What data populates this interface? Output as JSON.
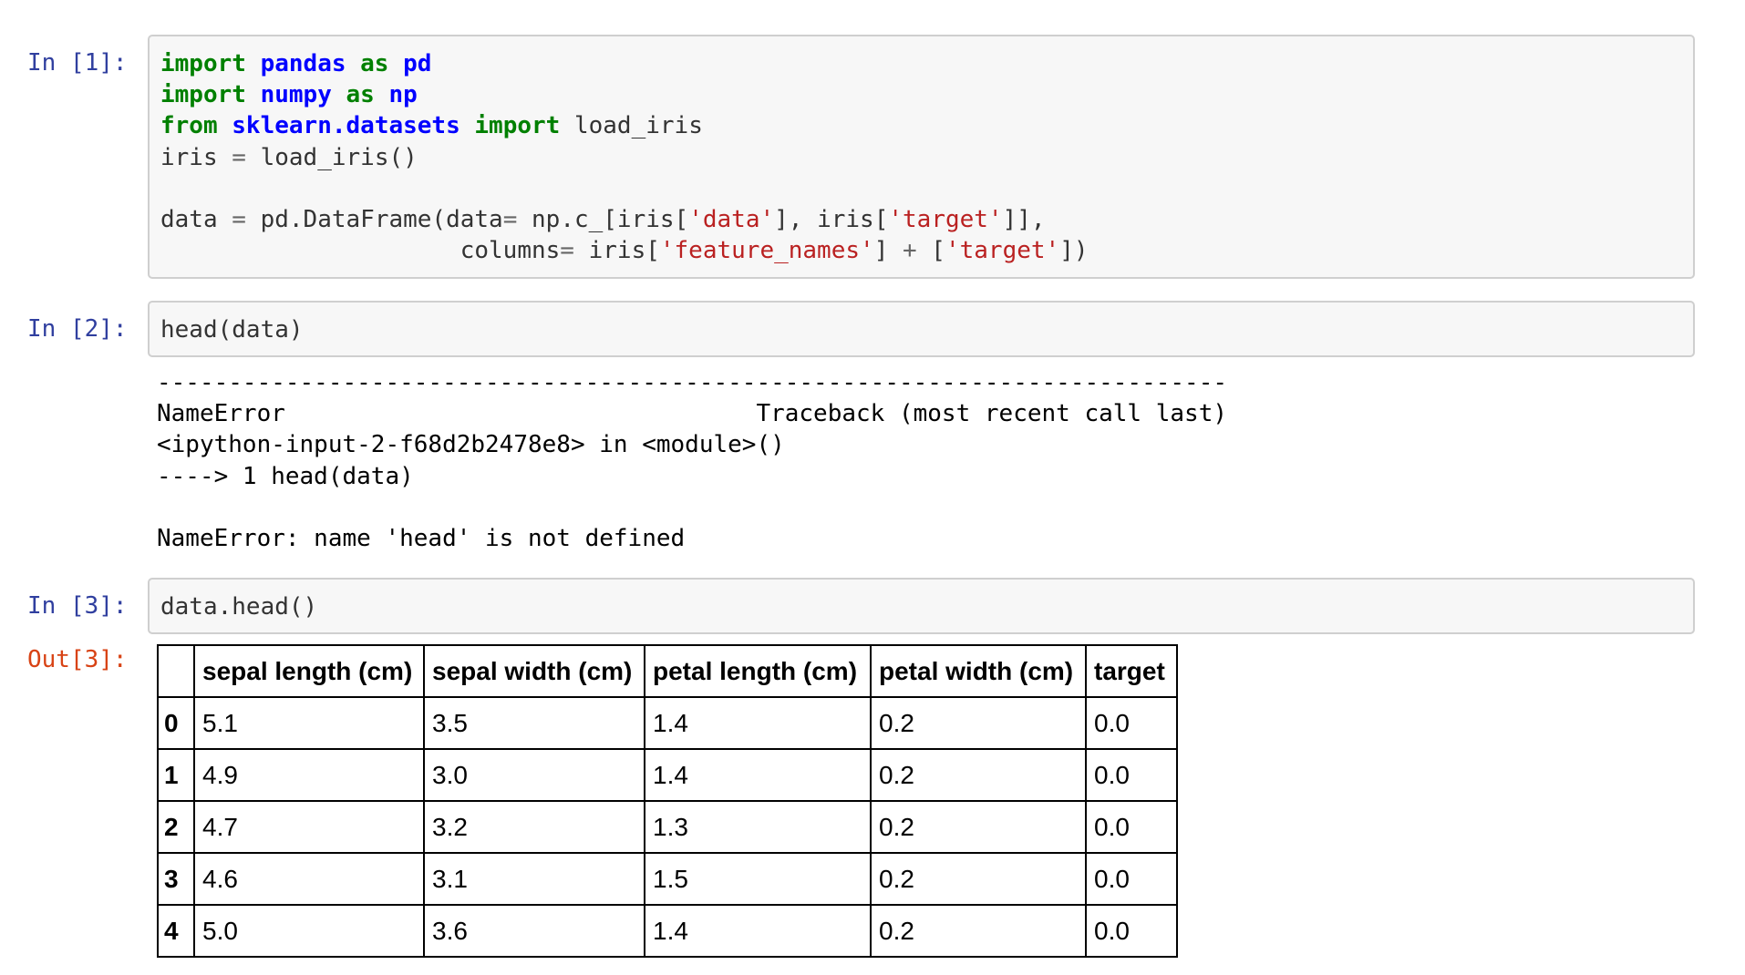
{
  "cells": [
    {
      "prompt": "In [1]:",
      "lines": [
        [
          [
            "kw",
            "import"
          ],
          [
            "t",
            " "
          ],
          [
            "mod",
            "pandas"
          ],
          [
            "t",
            " "
          ],
          [
            "kw",
            "as"
          ],
          [
            "t",
            " "
          ],
          [
            "mod",
            "pd"
          ]
        ],
        [
          [
            "kw",
            "import"
          ],
          [
            "t",
            " "
          ],
          [
            "mod",
            "numpy"
          ],
          [
            "t",
            " "
          ],
          [
            "kw",
            "as"
          ],
          [
            "t",
            " "
          ],
          [
            "mod",
            "np"
          ]
        ],
        [
          [
            "kw",
            "from"
          ],
          [
            "t",
            " "
          ],
          [
            "mod",
            "sklearn.datasets"
          ],
          [
            "t",
            " "
          ],
          [
            "kw",
            "import"
          ],
          [
            "t",
            " load_iris"
          ]
        ],
        [
          [
            "t",
            "iris "
          ],
          [
            "op",
            "="
          ],
          [
            "t",
            " load_iris()"
          ]
        ],
        [
          [
            "t",
            ""
          ]
        ],
        [
          [
            "t",
            "data "
          ],
          [
            "op",
            "="
          ],
          [
            "t",
            " pd.DataFrame(data"
          ],
          [
            "op",
            "="
          ],
          [
            "t",
            " np.c_[iris["
          ],
          [
            "str",
            "'data'"
          ],
          [
            "t",
            "], iris["
          ],
          [
            "str",
            "'target'"
          ],
          [
            "t",
            "]],"
          ]
        ],
        [
          [
            "t",
            "                     columns"
          ],
          [
            "op",
            "="
          ],
          [
            "t",
            " iris["
          ],
          [
            "str",
            "'feature_names'"
          ],
          [
            "t",
            "] "
          ],
          [
            "op",
            "+"
          ],
          [
            "t",
            " ["
          ],
          [
            "str",
            "'target'"
          ],
          [
            "t",
            "])"
          ]
        ]
      ]
    },
    {
      "prompt": "In [2]:",
      "lines": [
        [
          [
            "t",
            "head(data)"
          ]
        ]
      ]
    },
    {
      "prompt": "In [3]:",
      "lines": [
        [
          [
            "t",
            "data.head()"
          ]
        ]
      ]
    }
  ],
  "traceback": {
    "lines": [
      "---------------------------------------------------------------------------",
      "NameError                                 Traceback (most recent call last)",
      "<ipython-input-2-f68d2b2478e8> in <module>()",
      "----> 1 head(data)",
      "",
      "NameError: name 'head' is not defined"
    ]
  },
  "output3": {
    "prompt": "Out[3]:",
    "columns": [
      "sepal length (cm)",
      "sepal width (cm)",
      "petal length (cm)",
      "petal width (cm)",
      "target"
    ],
    "rows": [
      {
        "index": "0",
        "values": [
          "5.1",
          "3.5",
          "1.4",
          "0.2",
          "0.0"
        ]
      },
      {
        "index": "1",
        "values": [
          "4.9",
          "3.0",
          "1.4",
          "0.2",
          "0.0"
        ]
      },
      {
        "index": "2",
        "values": [
          "4.7",
          "3.2",
          "1.3",
          "0.2",
          "0.0"
        ]
      },
      {
        "index": "3",
        "values": [
          "4.6",
          "3.1",
          "1.5",
          "0.2",
          "0.0"
        ]
      },
      {
        "index": "4",
        "values": [
          "5.0",
          "3.6",
          "1.4",
          "0.2",
          "0.0"
        ]
      }
    ]
  }
}
